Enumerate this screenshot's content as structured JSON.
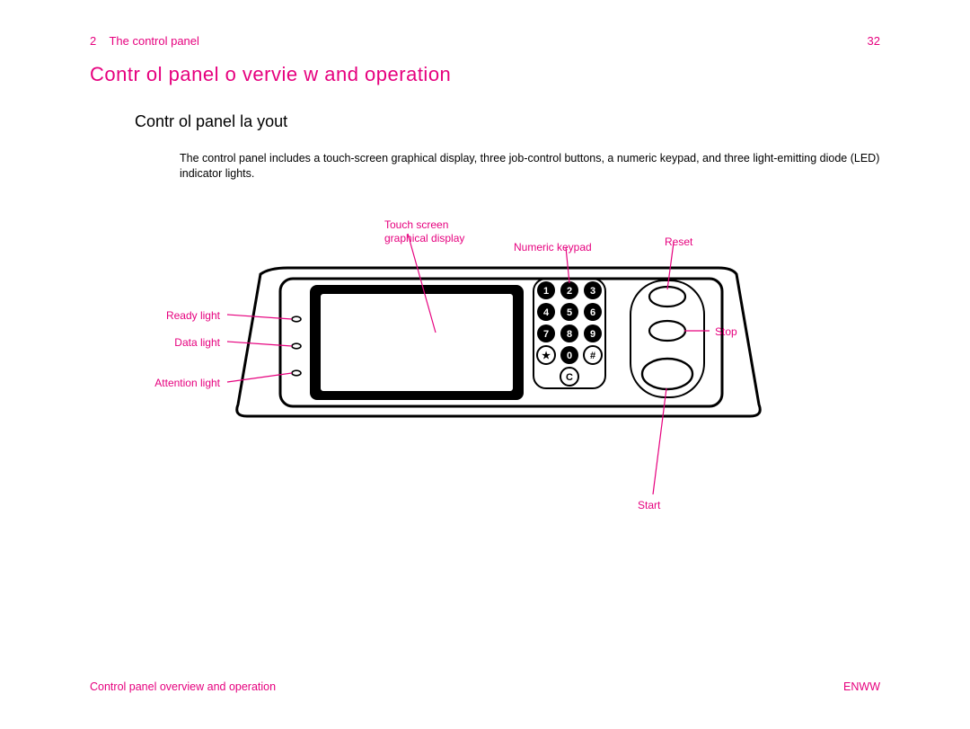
{
  "header": {
    "chapter_num": "2",
    "chapter_title": "The control panel",
    "page_num": "32"
  },
  "titles": {
    "h1": "Contr ol panel o vervie w and operation",
    "h2": "Contr ol panel la yout"
  },
  "body": "The control panel includes a touch-screen graphical display, three job-control buttons, a numeric keypad, and three light-emitting diode (LED) indicator lights.",
  "callouts": {
    "touchscreen_l1": "Touch screen",
    "touchscreen_l2": "graphical display",
    "numeric_keypad": "Numeric keypad",
    "reset": "Reset",
    "stop": "Stop",
    "start": "Start",
    "ready": "Ready light",
    "data": "Data light",
    "attention": "Attention light"
  },
  "keypad": [
    "1",
    "2",
    "3",
    "4",
    "5",
    "6",
    "7",
    "8",
    "9",
    "★",
    "0",
    "#",
    "C"
  ],
  "footer": {
    "left": "Control panel overview and operation",
    "right": "ENWW"
  }
}
